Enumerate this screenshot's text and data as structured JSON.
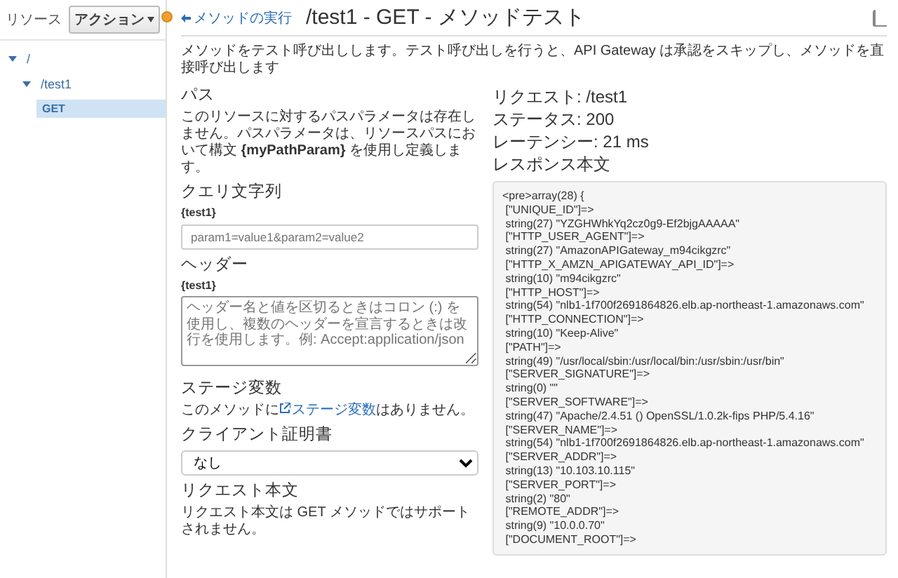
{
  "sidebar": {
    "title": "リソース",
    "action_button": "アクション",
    "tree": [
      {
        "label": "/",
        "expanded": true,
        "selected": false,
        "children": [
          {
            "label": "/test1",
            "expanded": true,
            "selected": false,
            "children": [
              {
                "label": "GET",
                "selected": true
              }
            ]
          }
        ]
      }
    ]
  },
  "header": {
    "back_link": "メソッドの実行",
    "title": "/test1 - GET - メソッドテスト"
  },
  "description": "メソッドをテスト呼び出しします。テスト呼び出しを行うと、API Gateway は承認をスキップし、メソッドを直接呼び出します",
  "path": {
    "heading": "パス",
    "text": "このリソースに対するパスパラメータは存在しません。パスパラメータは、リソースパスにおいて構文 **{myPathParam}** を使用し定義します。"
  },
  "query": {
    "heading": "クエリ文字列",
    "label": "{test1}",
    "placeholder": "param1=value1&param2=value2"
  },
  "headers": {
    "heading": "ヘッダー",
    "label": "{test1}",
    "placeholder": "ヘッダー名と値を区切るときはコロン (:) を使用し、複数のヘッダーを宣言するときは改行を使用します。例: Accept:application/json"
  },
  "stage_variables": {
    "heading": "ステージ変数",
    "before": "このメソッドに",
    "link": "ステージ変数",
    "after": "はありません。"
  },
  "client_certificate": {
    "heading": "クライアント証明書",
    "value": "なし"
  },
  "request_body": {
    "heading": "リクエスト本文",
    "text": "リクエスト本文は GET メソッドではサポートされません。"
  },
  "result": {
    "request": "リクエスト: /test1",
    "status": "ステータス: 200",
    "latency": "レーテンシー: 21 ms",
    "body_heading": "レスポンス本文"
  },
  "response_lines": [
    "<pre>array(28) {",
    " [\"UNIQUE_ID\"]=>",
    " string(27) \"YZGHWhkYq2cz0g9-Ef2bjgAAAAA\"",
    " [\"HTTP_USER_AGENT\"]=>",
    " string(27) \"AmazonAPIGateway_m94cikgzrc\"",
    " [\"HTTP_X_AMZN_APIGATEWAY_API_ID\"]=>",
    " string(10) \"m94cikgzrc\"",
    " [\"HTTP_HOST\"]=>",
    " string(54) \"nlb1-1f700f2691864826.elb.ap-northeast-1.amazonaws.com\"",
    " [\"HTTP_CONNECTION\"]=>",
    " string(10) \"Keep-Alive\"",
    " [\"PATH\"]=>",
    " string(49) \"/usr/local/sbin:/usr/local/bin:/usr/sbin:/usr/bin\"",
    " [\"SERVER_SIGNATURE\"]=>",
    " string(0) \"\"",
    " [\"SERVER_SOFTWARE\"]=>",
    " string(47) \"Apache/2.4.51 () OpenSSL/1.0.2k-fips PHP/5.4.16\"",
    " [\"SERVER_NAME\"]=>",
    " string(54) \"nlb1-1f700f2691864826.elb.ap-northeast-1.amazonaws.com\"",
    " [\"SERVER_ADDR\"]=>",
    " string(13) \"10.103.10.115\"",
    " [\"SERVER_PORT\"]=>",
    " string(2) \"80\"",
    " [\"REMOTE_ADDR\"]=>",
    " string(9) \"10.0.0.70\"",
    " [\"DOCUMENT_ROOT\"]=>"
  ]
}
